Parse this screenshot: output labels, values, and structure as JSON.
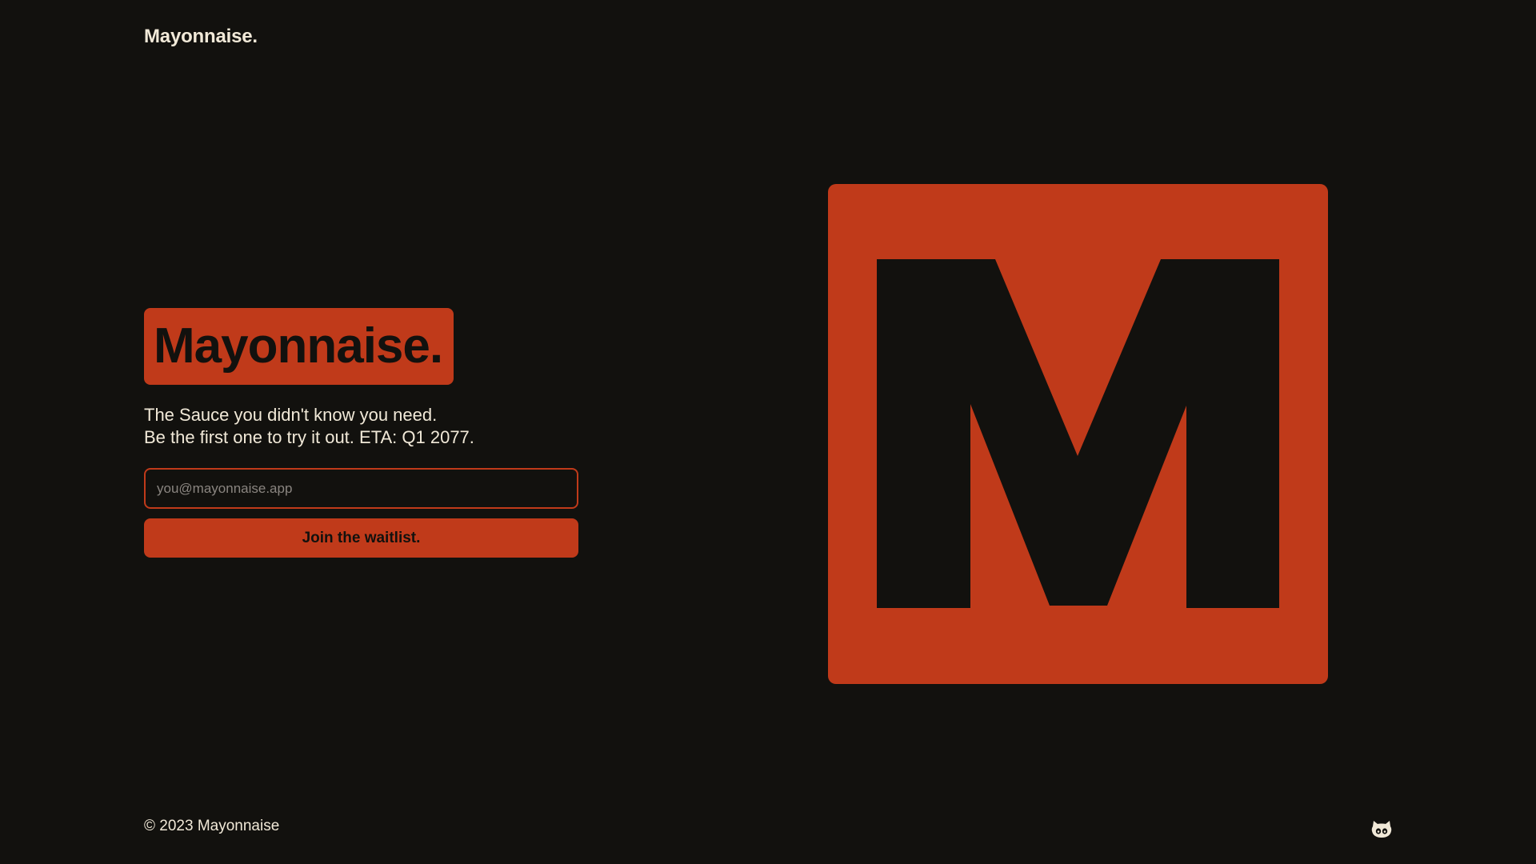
{
  "header": {
    "logo_text": "Mayonnaise."
  },
  "hero": {
    "title": "Mayonnaise.",
    "tagline_line1": "The Sauce you didn't know you need.",
    "tagline_line2": "Be the first one to try it out. ETA: Q1 2077.",
    "email_placeholder": "you@mayonnaise.app",
    "email_value": "",
    "join_button_label": "Join the waitlist."
  },
  "logo_mark": {
    "letter": "M",
    "background_color": "#c03a1a",
    "letter_color": "#12110e"
  },
  "footer": {
    "copyright": "© 2023 Mayonnaise",
    "social_icon": "github-icon"
  },
  "colors": {
    "page_background": "#12110e",
    "accent": "#c03a1a",
    "text": "#f1e9d8"
  }
}
